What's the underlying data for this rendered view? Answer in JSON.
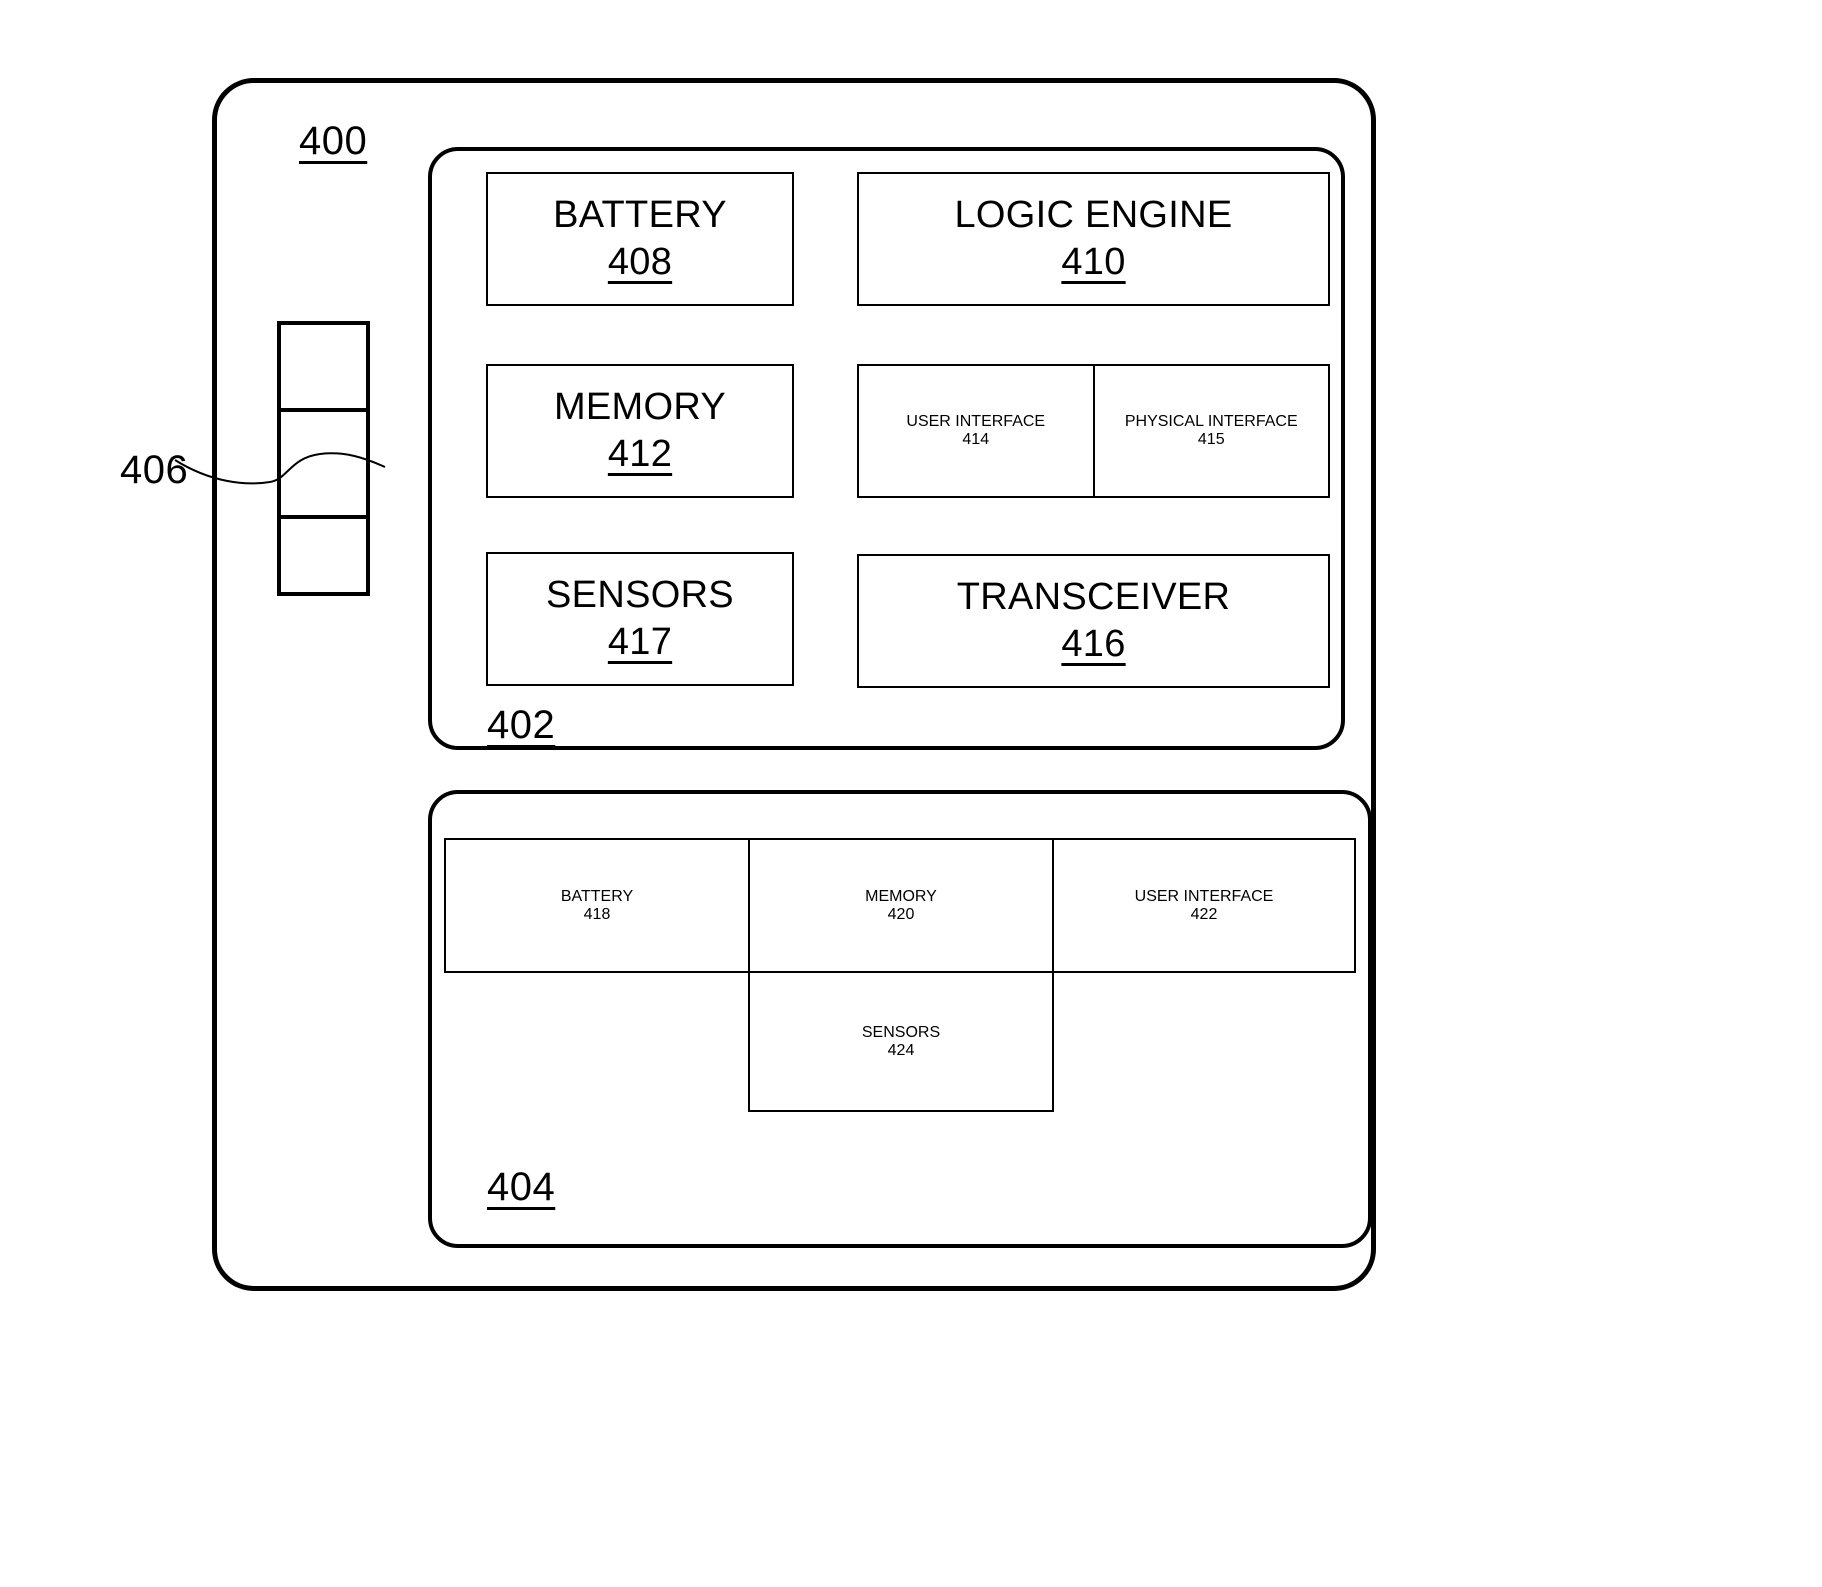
{
  "figure": {
    "device_ref": "400",
    "connector_ref": "406",
    "module_primary_ref": "402",
    "module_secondary_ref": "404"
  },
  "module_402": {
    "ref": "402",
    "components": [
      {
        "title": "BATTERY",
        "num": "408"
      },
      {
        "title": "LOGIC ENGINE",
        "num": "410"
      },
      {
        "title": "MEMORY",
        "num": "412"
      },
      {
        "title": "USER\nINTERFACE",
        "num": "414"
      },
      {
        "title": "PHYSICAL\nINTERFACE",
        "num": "415"
      },
      {
        "title": "SENSORS",
        "num": "417"
      },
      {
        "title": "TRANSCEIVER",
        "num": "416"
      }
    ]
  },
  "module_404": {
    "ref": "404",
    "components": [
      {
        "title": "BATTERY",
        "num": "418"
      },
      {
        "title": "MEMORY",
        "num": "420"
      },
      {
        "title": "USER\nINTERFACE",
        "num": "422"
      },
      {
        "title": "SENSORS",
        "num": "424"
      }
    ]
  }
}
